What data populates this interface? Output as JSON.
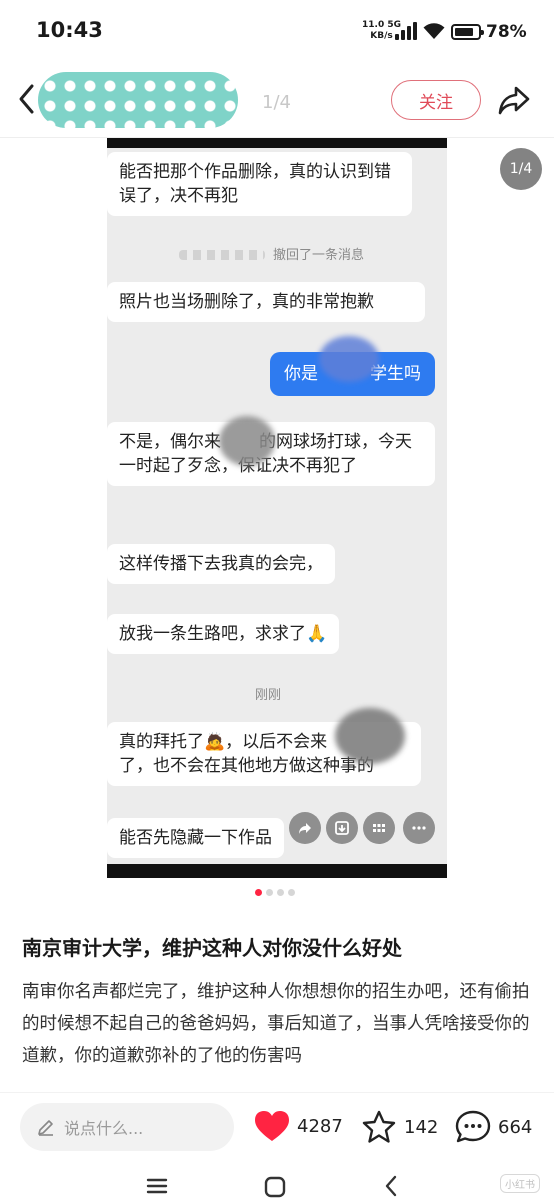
{
  "status_bar": {
    "time": "10:43",
    "net_speed": "11.0",
    "net_type": "5G",
    "net_unit": "KB/s",
    "battery": "78%"
  },
  "header": {
    "page_indicator": "1/4",
    "follow_label": "关注"
  },
  "image": {
    "page_badge": "1/4",
    "current_index": 1,
    "total": 4,
    "messages": {
      "m1": "能否把那个作品删除，真的认识到错误了，决不再犯",
      "recall": "撤回了一条消息",
      "m2": "照片也当场删除了，真的非常抱歉",
      "m3_a": "你是",
      "m3_b": "学生吗",
      "m4_a": "不是，偶尔来",
      "m4_b": "的网球场打球，今天一时起了歹念，保证决不再犯了",
      "m5": "这样传播下去我真的会完，",
      "m6": "放我一条生路吧，求求了🙏",
      "time_label": "刚刚",
      "m7_a": "真的拜托了🙇，以后不会来",
      "m7_b": "了，也不会在其他地方做这种事的",
      "m8": "能否先隐藏一下作品"
    }
  },
  "post": {
    "title": "南京审计大学，维护这种人对你没什么好处",
    "body": "南审你名声都烂完了，维护这种人你想想你的招生办吧，还有偷拍的时候想不起自己的爸爸妈妈，事后知道了，当事人凭啥接受你的道歉，你的道歉弥补的了他的伤害吗"
  },
  "bottom_bar": {
    "comment_placeholder": "说点什么...",
    "likes": "4287",
    "favorites": "142",
    "comments": "664"
  },
  "watermark": "小红书",
  "colors": {
    "accent": "#ff2442",
    "like": "#ff2442",
    "blue_bubble": "#2e7bf0"
  },
  "icons": [
    "back-icon",
    "share-icon",
    "heart-icon",
    "star-icon",
    "comment-icon",
    "pen-icon"
  ]
}
